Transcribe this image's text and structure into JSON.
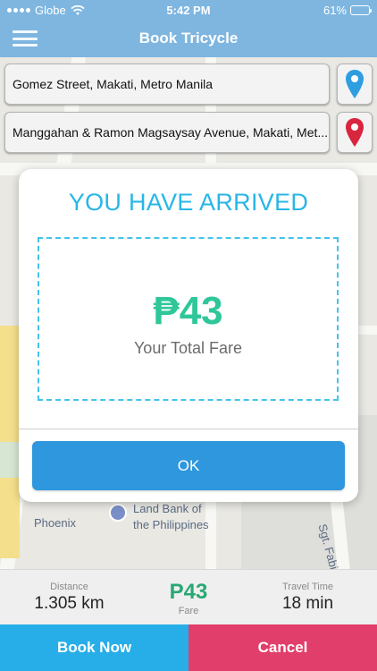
{
  "status_bar": {
    "carrier": "Globe",
    "time": "5:42 PM",
    "battery": "61%",
    "battery_level": 0.61
  },
  "header": {
    "title": "Book Tricycle",
    "menu_icon": "hamburger-menu-icon"
  },
  "locations": {
    "origin": "Gomez Street, Makati, Metro Manila",
    "destination": "Manggahan & Ramon Magsaysay Avenue, Makati, Met...",
    "origin_pin_color": "#2e9ee0",
    "destination_pin_color": "#d9263f"
  },
  "map": {
    "labels": [
      "Land Bank of",
      "the Philippines",
      "Phoenix",
      "Sgt. Fabi"
    ]
  },
  "modal": {
    "heading": "YOU HAVE ARRIVED",
    "fare_amount": "₱43",
    "fare_caption": "Your Total Fare",
    "ok_label": "OK"
  },
  "trip_info": {
    "distance_label": "Distance",
    "distance_value": "1.305 km",
    "fare_value": "P43",
    "fare_label": "Fare",
    "time_label": "Travel Time",
    "time_value": "18 min"
  },
  "actions": {
    "book_now": "Book Now",
    "cancel": "Cancel"
  },
  "colors": {
    "header": "#7eb6e0",
    "accent_blue": "#2e97dd",
    "fare_green": "#2fc79a",
    "cancel_red": "#e23e6c",
    "book_blue": "#27aee8"
  }
}
